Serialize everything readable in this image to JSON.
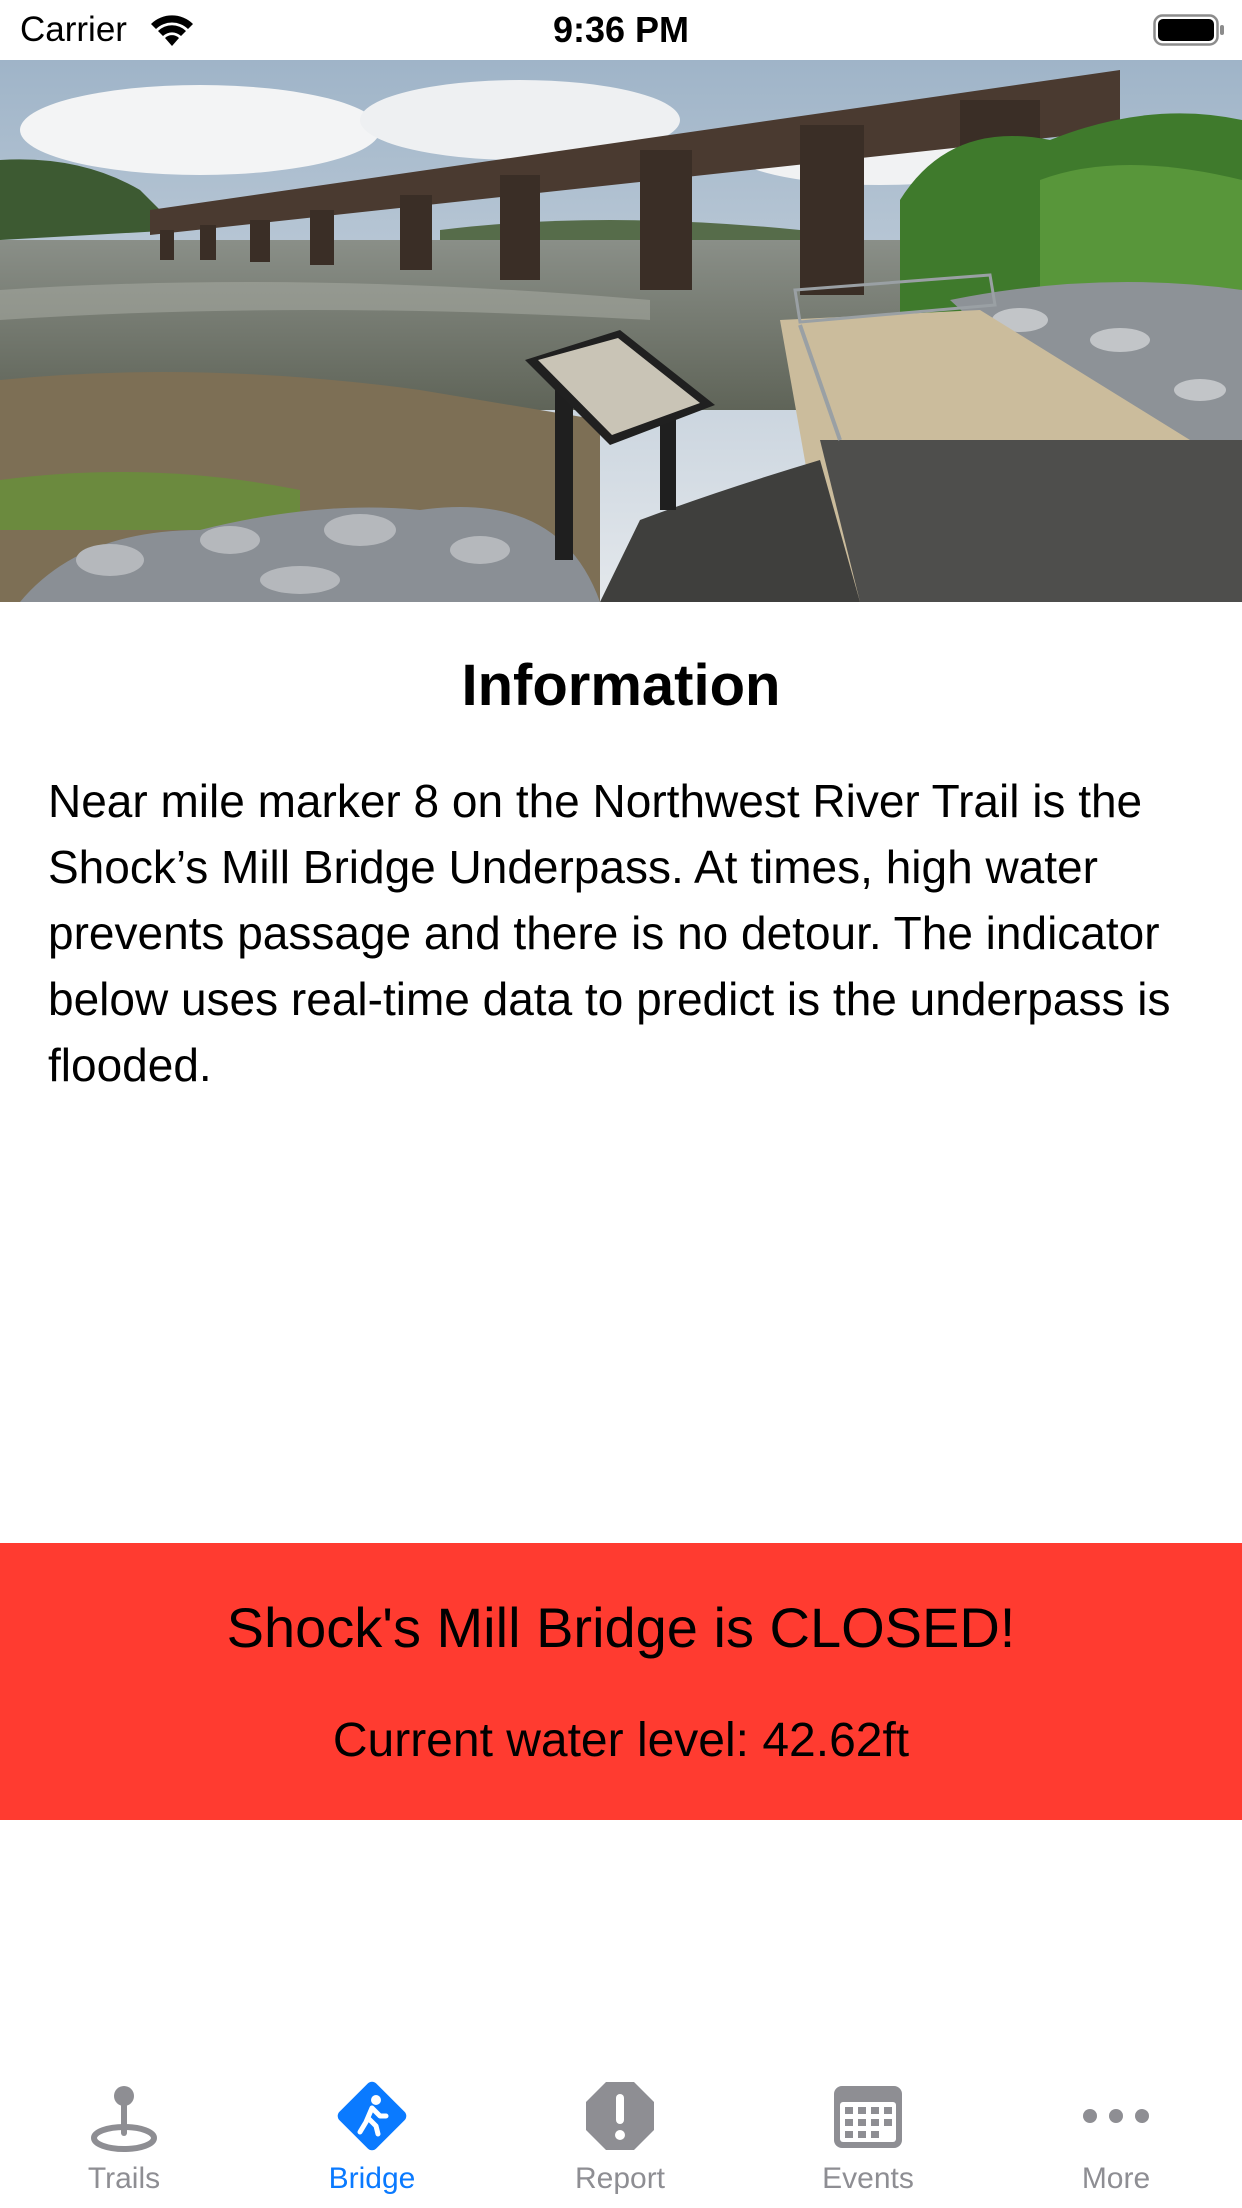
{
  "status_bar": {
    "carrier": "Carrier",
    "time": "9:36 PM"
  },
  "hero": {
    "image": "river-railroad-bridge-trail-photo"
  },
  "info": {
    "title": "Information",
    "body": "Near mile marker 8 on the Northwest River Trail is the Shock’s Mill Bridge Underpass. At times, high water prevents passage and there is no detour. The indicator below uses real-time data to predict is the underpass is flooded."
  },
  "bridge_status": {
    "headline": "Shock's Mill Bridge is CLOSED!",
    "water_level_label": "Current water level:",
    "water_level_value": "42.62ft",
    "banner_color": "#ff3b30"
  },
  "tab_bar": {
    "active_color": "#0a7aff",
    "inactive_color": "#8e8e93",
    "tabs": [
      {
        "label": "Trails",
        "icon": "map-pin-icon",
        "active": false
      },
      {
        "label": "Bridge",
        "icon": "walking-sign-icon",
        "active": true
      },
      {
        "label": "Report",
        "icon": "exclamation-icon",
        "active": false
      },
      {
        "label": "Events",
        "icon": "calendar-icon",
        "active": false
      },
      {
        "label": "More",
        "icon": "more-dots-icon",
        "active": false
      }
    ]
  }
}
